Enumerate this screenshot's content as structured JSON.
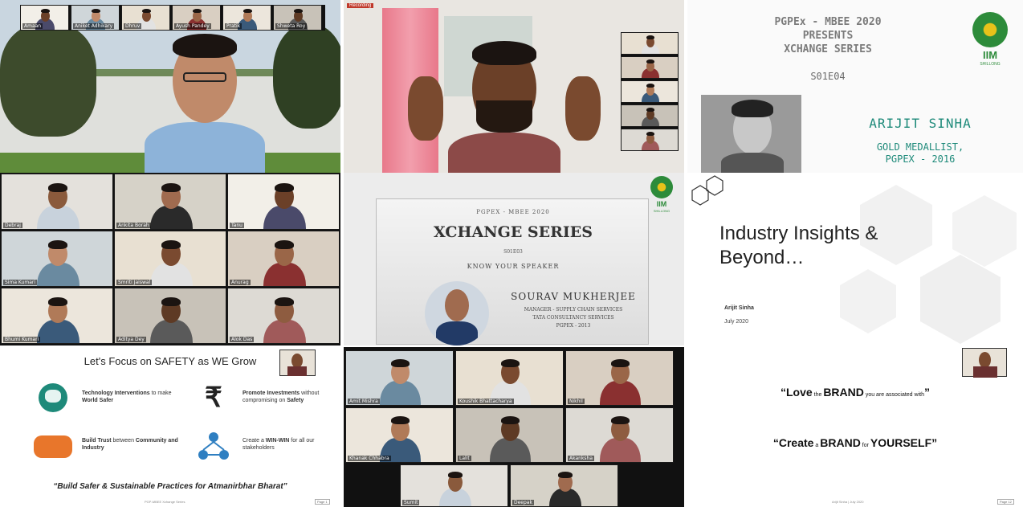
{
  "top_strip": {
    "names": [
      "Amaan",
      "Aniket Adhikary",
      "Dhruv",
      "Ayush Pandey",
      "Pratik",
      "Shweta Roy"
    ]
  },
  "speaker1": {
    "name": "Sourav Mukherjee"
  },
  "speaker2": {
    "badge": "Recording"
  },
  "grid1": {
    "names": [
      "Debraj",
      "Ankita Borah",
      "Tanu",
      "Sima Kumari",
      "Smriti Jaiswal",
      "Anurag",
      "Bhumi Kumari",
      "Aditya Dey",
      "Alok Das"
    ]
  },
  "title_slide": {
    "line1": "PGPEx - MBEE 2020",
    "line2": "PRESENTS",
    "line3": "XCHANGE SERIES",
    "episode": "S01E04",
    "logo": "IIM",
    "logo_sub": "SHILLONG",
    "speaker": "ARIJIT SINHA",
    "award1": "GOLD MEDALLIST,",
    "award2": "PGPEX - 2016"
  },
  "banner": {
    "top": "PGPEX - MBEE 2020",
    "title": "XCHANGE SERIES",
    "ep": "S01E03",
    "kys": "KNOW YOUR SPEAKER",
    "speaker": "SOURAV MUKHERJEE",
    "role": "MANAGER - SUPPLY CHAIN SERVICES",
    "company": "TATA CONSULTANCY SERVICES",
    "batch": "PGPEX - 2013",
    "logo": "IIM",
    "logo_sub": "SHILLONG"
  },
  "insights": {
    "title1": "Industry Insights &",
    "title2": "Beyond…",
    "author": "Arijit Sinha",
    "date": "July 2020"
  },
  "safety": {
    "heading": "Let's Focus on SAFETY as WE Grow",
    "items": [
      {
        "pre": "Technology Interventions",
        "mid": " to make ",
        "post": "World Safer",
        "icon": "globe-icon"
      },
      {
        "pre": "Promote Investments",
        "mid": " without compromising on ",
        "post": "Safety",
        "icon": "rupee-icon"
      },
      {
        "pre": "Build Trust",
        "mid": " between ",
        "post": "Community and Industry",
        "icon": "handshake-icon"
      },
      {
        "pre": "Create a ",
        "mid": "WIN-WIN",
        "post": " for all our stakeholders",
        "icon": "network-icon"
      }
    ],
    "footer": "“Build Safer & Sustainable Practices for Atmanirbhar Bharat”",
    "foot_small": "PGP-MBEE Xchange Series",
    "page": "Page 1"
  },
  "grid2": {
    "names": [
      "Amit Mishra",
      "Koushik Bhattacharya",
      "Nikhil",
      "Khanak Chhabra",
      "Lalit",
      "Akanksha",
      "Sumit",
      "Deepak"
    ]
  },
  "quotes": {
    "q1a": "“Love",
    "q1b": " the ",
    "q1c": "BRAND",
    "q1d": " you are associated with",
    "q1e": "”",
    "q2a": "“Create",
    "q2b": " a ",
    "q2c": "BRAND",
    "q2d": " for ",
    "q2e": "YOURSELF”",
    "foot_small": "Arijit Sinha | July 2020",
    "page": "Page 12"
  },
  "colors": {
    "teal": "#1e8a7a",
    "orange": "#e8762b",
    "blue": "#2f7fc1",
    "iim_green": "#2d8b3a",
    "iim_yellow": "#e8c21a"
  }
}
